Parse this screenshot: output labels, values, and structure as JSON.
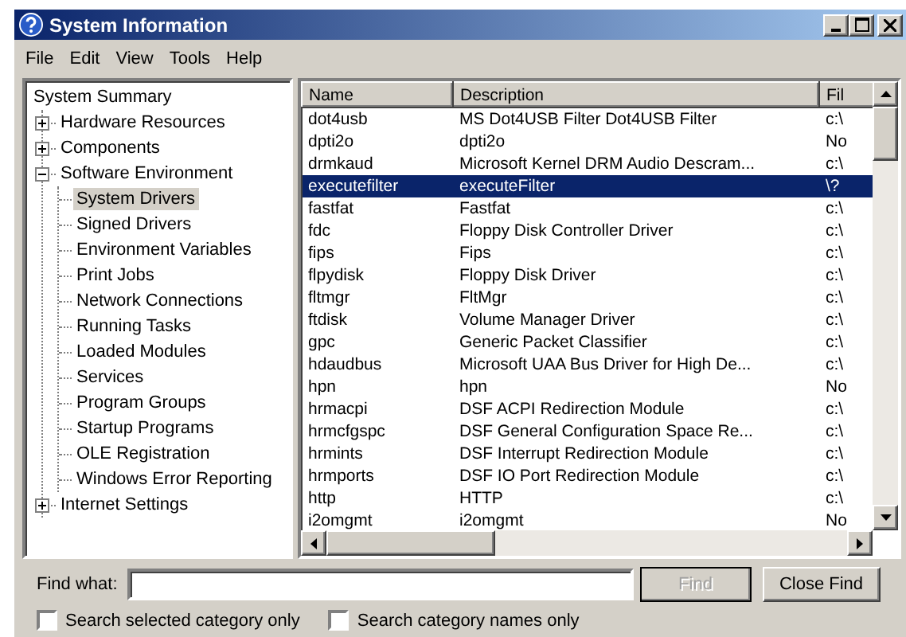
{
  "window": {
    "title": "System Information"
  },
  "menu": [
    "File",
    "Edit",
    "View",
    "Tools",
    "Help"
  ],
  "tree": [
    {
      "label": "System Summary",
      "selected": false
    },
    {
      "label": "Hardware Resources",
      "expanded": false,
      "selected": false
    },
    {
      "label": "Components",
      "expanded": false,
      "selected": false
    },
    {
      "label": "Software Environment",
      "expanded": true,
      "selected": false,
      "children": [
        {
          "label": "System Drivers",
          "selected": true
        },
        {
          "label": "Signed Drivers",
          "selected": false
        },
        {
          "label": "Environment Variables",
          "selected": false
        },
        {
          "label": "Print Jobs",
          "selected": false
        },
        {
          "label": "Network Connections",
          "selected": false
        },
        {
          "label": "Running Tasks",
          "selected": false
        },
        {
          "label": "Loaded Modules",
          "selected": false
        },
        {
          "label": "Services",
          "selected": false
        },
        {
          "label": "Program Groups",
          "selected": false
        },
        {
          "label": "Startup Programs",
          "selected": false
        },
        {
          "label": "OLE Registration",
          "selected": false
        },
        {
          "label": "Windows Error Reporting",
          "selected": false
        }
      ]
    },
    {
      "label": "Internet Settings",
      "expanded": false,
      "selected": false
    }
  ],
  "table": {
    "columns": [
      "Name",
      "Description",
      "Fil"
    ],
    "rows": [
      {
        "cells": [
          "dot4usb",
          "MS Dot4USB Filter Dot4USB Filter",
          "c:\\"
        ],
        "selected": false
      },
      {
        "cells": [
          "dpti2o",
          "dpti2o",
          "No"
        ],
        "selected": false
      },
      {
        "cells": [
          "drmkaud",
          "Microsoft Kernel DRM Audio Descram...",
          "c:\\"
        ],
        "selected": false
      },
      {
        "cells": [
          "executefilter",
          "executeFilter",
          "\\?"
        ],
        "selected": true
      },
      {
        "cells": [
          "fastfat",
          "Fastfat",
          "c:\\"
        ],
        "selected": false
      },
      {
        "cells": [
          "fdc",
          "Floppy Disk Controller Driver",
          "c:\\"
        ],
        "selected": false
      },
      {
        "cells": [
          "fips",
          "Fips",
          "c:\\"
        ],
        "selected": false
      },
      {
        "cells": [
          "flpydisk",
          "Floppy Disk Driver",
          "c:\\"
        ],
        "selected": false
      },
      {
        "cells": [
          "fltmgr",
          "FltMgr",
          "c:\\"
        ],
        "selected": false
      },
      {
        "cells": [
          "ftdisk",
          "Volume Manager Driver",
          "c:\\"
        ],
        "selected": false
      },
      {
        "cells": [
          "gpc",
          "Generic Packet Classifier",
          "c:\\"
        ],
        "selected": false
      },
      {
        "cells": [
          "hdaudbus",
          "Microsoft UAA Bus Driver for High De...",
          "c:\\"
        ],
        "selected": false
      },
      {
        "cells": [
          "hpn",
          "hpn",
          "No"
        ],
        "selected": false
      },
      {
        "cells": [
          "hrmacpi",
          "DSF ACPI Redirection Module",
          "c:\\"
        ],
        "selected": false
      },
      {
        "cells": [
          "hrmcfgspc",
          "DSF General Configuration Space Re...",
          "c:\\"
        ],
        "selected": false
      },
      {
        "cells": [
          "hrmints",
          "DSF Interrupt Redirection Module",
          "c:\\"
        ],
        "selected": false
      },
      {
        "cells": [
          "hrmports",
          "DSF IO Port Redirection Module",
          "c:\\"
        ],
        "selected": false
      },
      {
        "cells": [
          "http",
          "HTTP",
          "c:\\"
        ],
        "selected": false
      },
      {
        "cells": [
          "i2omgmt",
          "i2omgmt",
          "No"
        ],
        "selected": false
      }
    ]
  },
  "find": {
    "label": "Find what:",
    "buttons": [
      {
        "label": "Find",
        "disabled": true
      },
      {
        "label": "Close Find",
        "disabled": false
      }
    ],
    "options": [
      {
        "label": "Search selected category only",
        "checked": false
      },
      {
        "label": "Search category names only",
        "checked": false
      }
    ]
  }
}
